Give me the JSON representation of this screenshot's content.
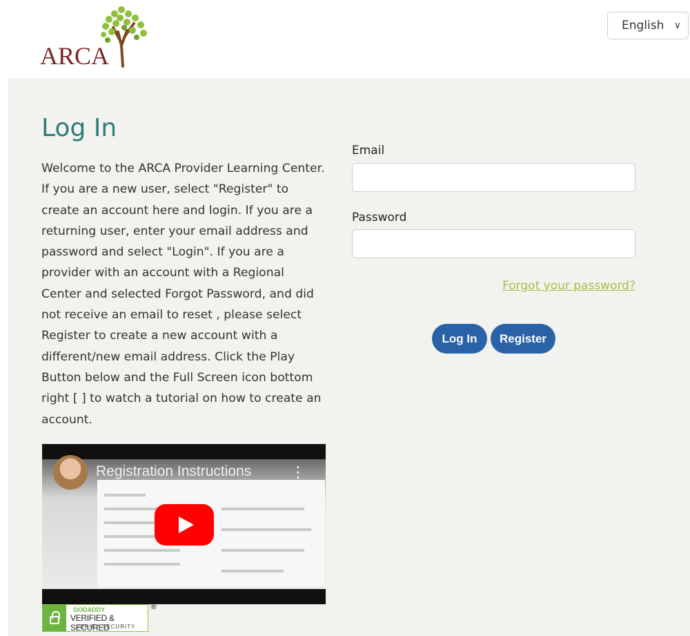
{
  "header": {
    "logo_text": "ARCA",
    "language_selected": "English"
  },
  "page": {
    "title": "Log In",
    "intro": "Welcome to the ARCA Provider Learning Center. If you are a new user, select \"Register\" to create an account here and login. If you are a returning user, enter your email address and password and select \"Login\". If you are a provider with an account with a Regional Center and selected Forgot Password, and did not receive an email to reset , please select Register to create a new account with a different/new email address. Click the Play Button below and the Full Screen icon bottom right [ ] to watch a tutorial on how to create an account."
  },
  "video": {
    "title": "Registration Instructions"
  },
  "badge": {
    "line1": "GODADDY",
    "line2": "VERIFIED & SECURED",
    "line3": "VERIFY SECURITY",
    "reg_mark": "®"
  },
  "form": {
    "email_label": "Email",
    "email_value": "",
    "password_label": "Password",
    "password_value": "",
    "forgot_link": "Forgot your password?",
    "login_button": "Log In",
    "register_button": "Register"
  },
  "colors": {
    "title": "#2e7d77",
    "logo": "#7a2424",
    "button": "#2a62a8",
    "link": "#a9bd4a",
    "panel_bg": "#f2f2ef"
  }
}
